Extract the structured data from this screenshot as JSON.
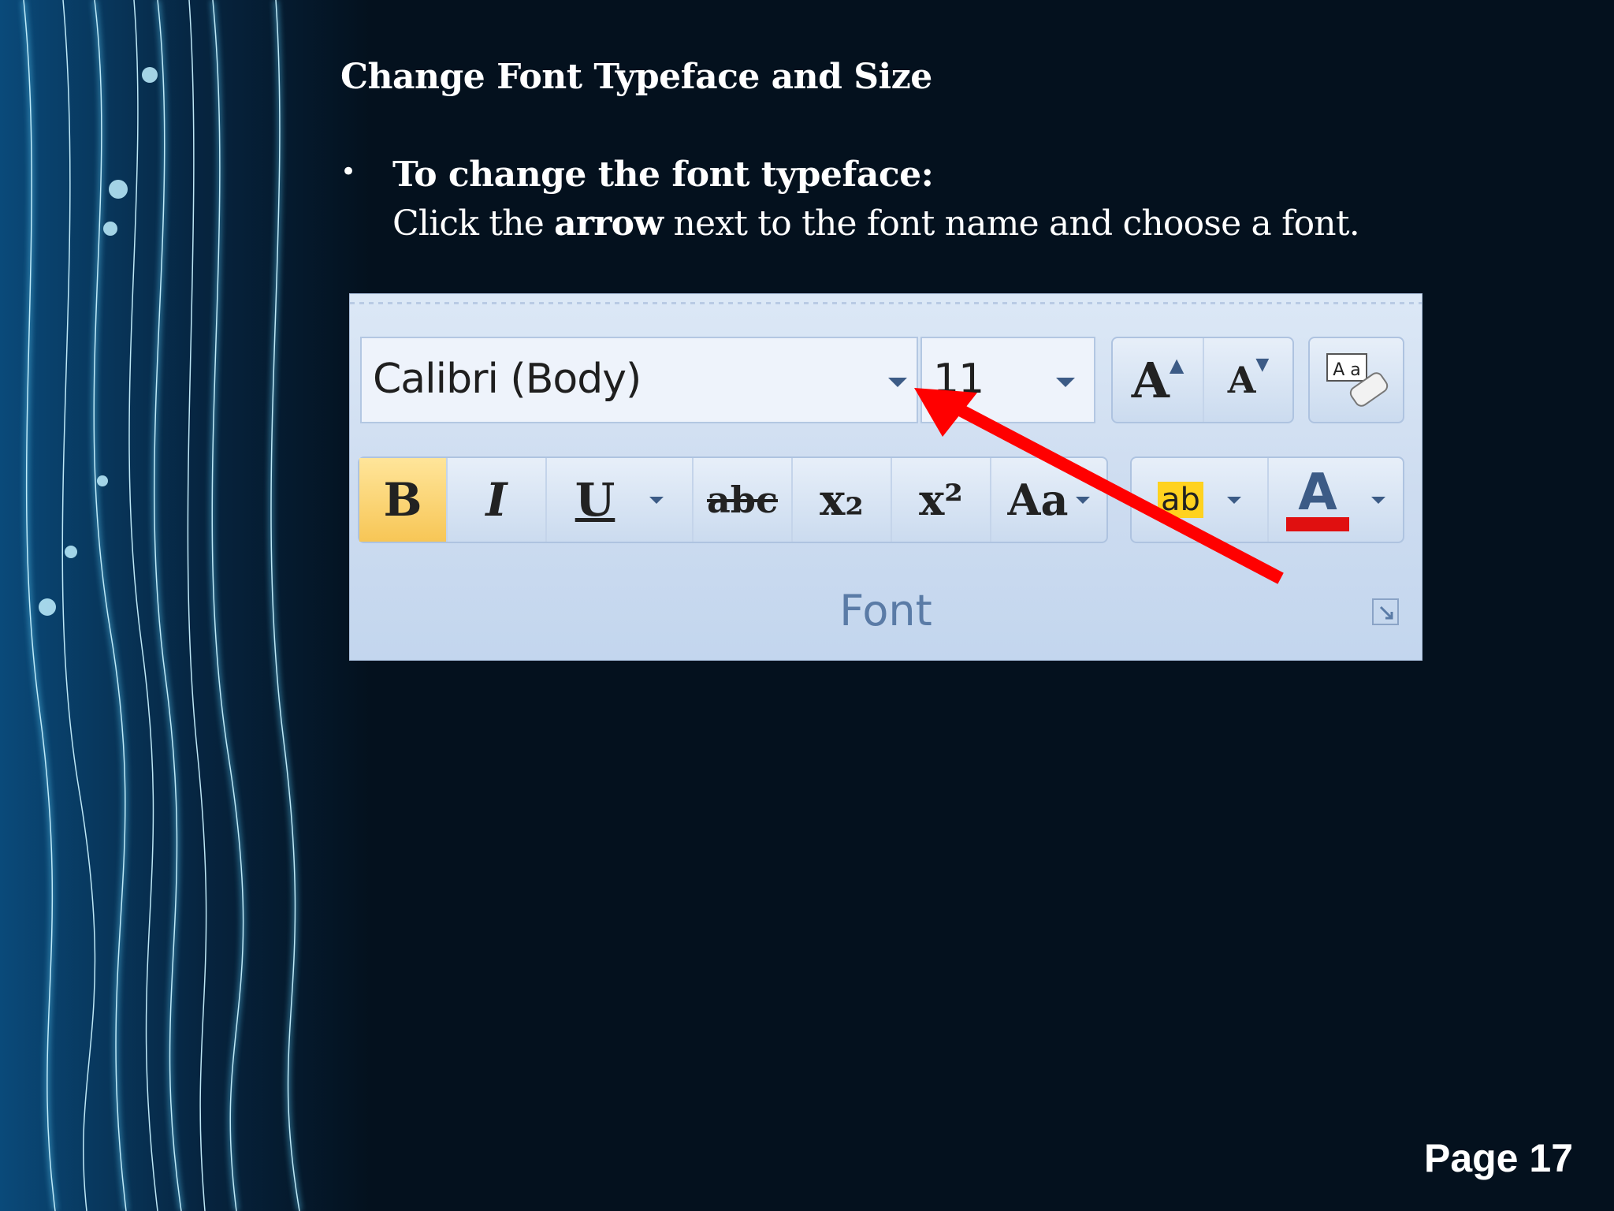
{
  "slide": {
    "title": "Change Font Typeface and Size",
    "bullet": {
      "marker": "•",
      "heading": "To change the font typeface:",
      "body_before": "Click the ",
      "body_bold": "arrow",
      "body_after": " next to the font name and choose a font."
    },
    "page_label": "Page 17"
  },
  "ribbon": {
    "font_name": "Calibri (Body)",
    "font_size": "11",
    "grow_font_glyph": "A",
    "shrink_font_glyph": "A",
    "clear_format_glyph": "A a",
    "bold_glyph": "B",
    "italic_glyph": "I",
    "underline_glyph": "U",
    "strike_glyph": "abc",
    "subscript_glyph": "x₂",
    "superscript_glyph": "x²",
    "change_case_glyph": "Aa",
    "highlight_glyph": "ab",
    "font_color_glyph": "A",
    "group_label": "Font",
    "highlight_color": "#ffd21f",
    "font_color": "#e01010"
  },
  "annotation_color": "#ff0000"
}
